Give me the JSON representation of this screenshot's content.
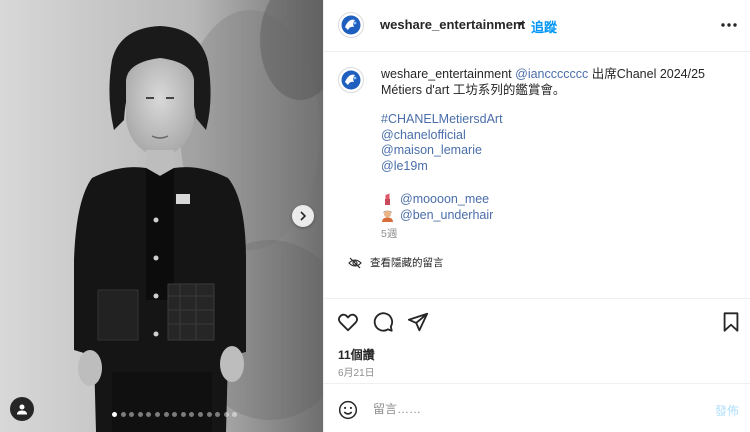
{
  "post": {
    "author": "weshare_entertainment",
    "separator": "•",
    "follow_label": "追蹤",
    "image_count": 15,
    "active_image": 0
  },
  "caption": {
    "author": "weshare_entertainment",
    "mention": "@ianccccccc",
    "text_after_mention": "出席Chanel 2024/25",
    "line2": "Métiers d'art 工坊系列的鑑賞會。",
    "tags": [
      "#CHANELMetiersdArt",
      "@chanelofficial",
      "@maison_lemarie",
      "@le19m"
    ],
    "credits": [
      {
        "icon": "lipstick-icon",
        "handle": "@moooon_mee"
      },
      {
        "icon": "haircut-icon",
        "handle": "@ben_underhair"
      }
    ],
    "age": "5週",
    "hidden_comments_label": "查看隱藏的留言"
  },
  "actions": {
    "icons": [
      "heart-icon",
      "comment-icon",
      "share-icon",
      "bookmark-icon"
    ],
    "likes": "11個讚",
    "date": "6月21日"
  },
  "comment_box": {
    "placeholder": "留言……",
    "post_label": "發佈"
  },
  "colors": {
    "follow": "#0095f6",
    "link": "#4a6ea9",
    "post_disabled": "#b2dffc",
    "muted": "#8e8e8e"
  }
}
